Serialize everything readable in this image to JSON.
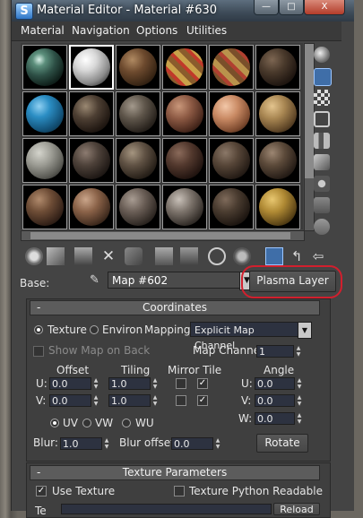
{
  "window": {
    "title": "Material Editor - Material #630",
    "logo": "S",
    "min_glyph": "—",
    "max_glyph": "□",
    "close_glyph": "X"
  },
  "menu": [
    "Material",
    "Navigation",
    "Options",
    "Utilities"
  ],
  "sample_slots_visible": 24,
  "selected_slot": 1,
  "base": {
    "label": "Base:",
    "map_value": "Map #602",
    "type_button": "Plasma Layer",
    "dropdown_glyph": "▼"
  },
  "coordinates": {
    "title": "Coordinates",
    "collapse": "-",
    "texture_label": "Texture",
    "environ_label": "Environ",
    "mapping_label": "Mapping:",
    "mapping_value": "Explicit Map Channel",
    "show_map_on_back": "Show Map on Back",
    "map_channel_label": "Map Channel:",
    "map_channel_value": "1",
    "offset_label": "Offset",
    "tiling_label": "Tiling",
    "mirror_tile_label": "Mirror Tile",
    "angle_label": "Angle",
    "u_label": "U:",
    "v_label": "V:",
    "w_label": "W:",
    "offset_u": "0.0",
    "offset_v": "0.0",
    "tiling_u": "1.0",
    "tiling_v": "1.0",
    "angle_u": "0.0",
    "angle_v": "0.0",
    "angle_w": "0.0",
    "uv_label": "UV",
    "vw_label": "VW",
    "wu_label": "WU",
    "blur_label": "Blur:",
    "blur_value": "1.0",
    "blur_offset_label": "Blur offset:",
    "blur_offset_value": "0.0",
    "rotate_label": "Rotate"
  },
  "texture_params": {
    "title": "Texture Parameters",
    "collapse": "-",
    "use_texture": "Use Texture",
    "python_readable": "Texture Python Readable",
    "cut_label_1": "Te",
    "cut_label_2": "Reload"
  }
}
